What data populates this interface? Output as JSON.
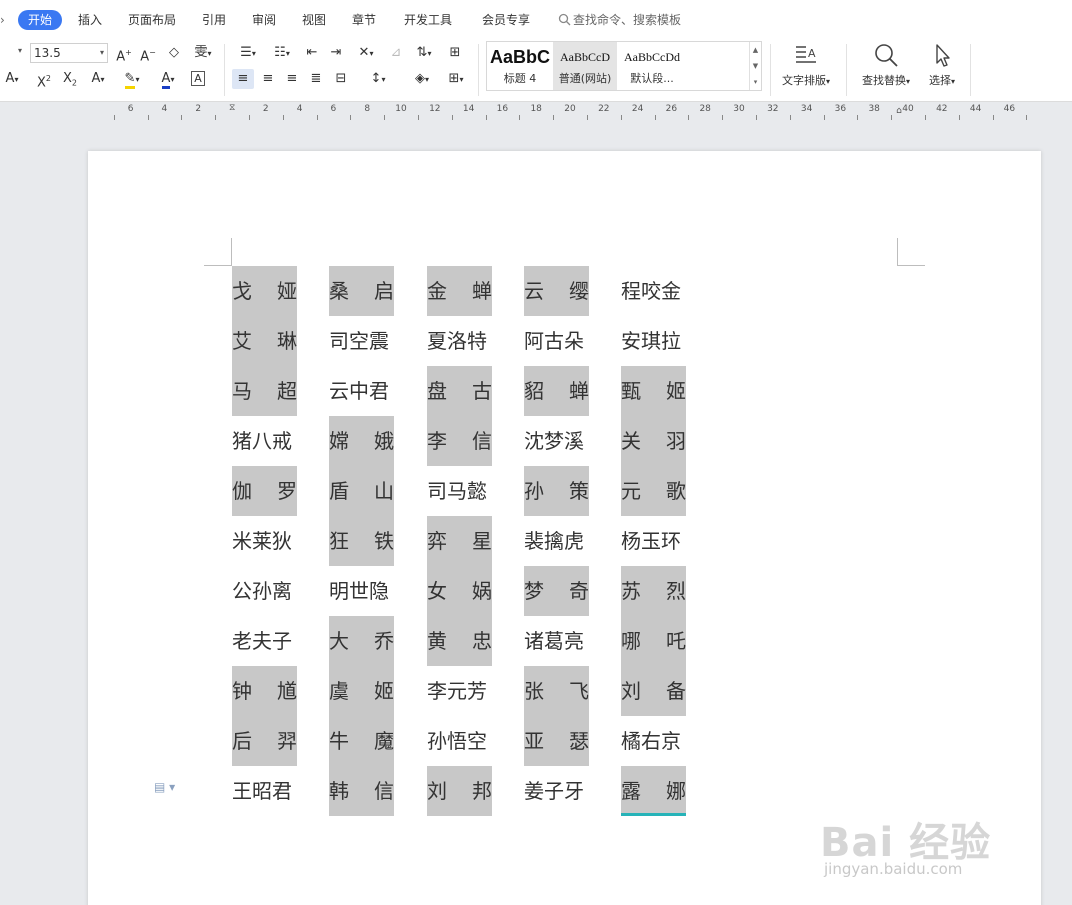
{
  "menu": {
    "items": [
      "开始",
      "插入",
      "页面布局",
      "引用",
      "审阅",
      "视图",
      "章节",
      "开发工具",
      "会员专享"
    ],
    "active_index": 0,
    "search_placeholder": "查找命令、搜索模板"
  },
  "ribbon": {
    "font_size": "13.5",
    "styles": [
      {
        "preview": "AaBbC",
        "label": "标题 4"
      },
      {
        "preview": "AaBbCcD",
        "label": "普通(网站)"
      },
      {
        "preview": "AaBbCcDd",
        "label": "默认段..."
      }
    ],
    "text_layout_label": "文字排版",
    "find_replace_label": "查找替换",
    "select_label": "选择"
  },
  "ruler": {
    "left_labels": [
      "6",
      "4",
      "2"
    ],
    "right_labels": [
      "2",
      "4",
      "6",
      "8",
      "10",
      "12",
      "14",
      "16",
      "18",
      "20",
      "22",
      "24",
      "26",
      "28",
      "30",
      "32",
      "34",
      "36",
      "38",
      "40",
      "42",
      "44",
      "46"
    ]
  },
  "document": {
    "columns": [
      [
        {
          "text": "戈 娅",
          "hl": true
        },
        {
          "text": "艾 琳",
          "hl": true
        },
        {
          "text": "马 超",
          "hl": true
        },
        {
          "text": "猪八戒",
          "hl": false
        },
        {
          "text": "伽 罗",
          "hl": true
        },
        {
          "text": "米莱狄",
          "hl": false
        },
        {
          "text": "公孙离",
          "hl": false
        },
        {
          "text": "老夫子",
          "hl": false
        },
        {
          "text": "钟 馗",
          "hl": true
        },
        {
          "text": "后 羿",
          "hl": true
        },
        {
          "text": "王昭君",
          "hl": false
        }
      ],
      [
        {
          "text": "桑 启",
          "hl": true
        },
        {
          "text": "司空震",
          "hl": false
        },
        {
          "text": "云中君",
          "hl": false
        },
        {
          "text": "嫦 娥",
          "hl": true
        },
        {
          "text": "盾 山",
          "hl": true
        },
        {
          "text": "狂 铁",
          "hl": true
        },
        {
          "text": "明世隐",
          "hl": false
        },
        {
          "text": "大 乔",
          "hl": true
        },
        {
          "text": "虞 姬",
          "hl": true
        },
        {
          "text": "牛 魔",
          "hl": true
        },
        {
          "text": "韩 信",
          "hl": true
        }
      ],
      [
        {
          "text": "金 蝉",
          "hl": true
        },
        {
          "text": "夏洛特",
          "hl": false
        },
        {
          "text": "盘 古",
          "hl": true
        },
        {
          "text": "李 信",
          "hl": true
        },
        {
          "text": "司马懿",
          "hl": false
        },
        {
          "text": "弈 星",
          "hl": true
        },
        {
          "text": "女 娲",
          "hl": true
        },
        {
          "text": "黄 忠",
          "hl": true
        },
        {
          "text": "李元芳",
          "hl": false
        },
        {
          "text": "孙悟空",
          "hl": false
        },
        {
          "text": "刘 邦",
          "hl": true
        }
      ],
      [
        {
          "text": "云 缨",
          "hl": true
        },
        {
          "text": "阿古朵",
          "hl": false
        },
        {
          "text": "貂 蝉",
          "hl": true
        },
        {
          "text": "沈梦溪",
          "hl": false
        },
        {
          "text": "孙 策",
          "hl": true
        },
        {
          "text": "裴擒虎",
          "hl": false
        },
        {
          "text": "梦 奇",
          "hl": true
        },
        {
          "text": "诸葛亮",
          "hl": false
        },
        {
          "text": "张 飞",
          "hl": true
        },
        {
          "text": "亚 瑟",
          "hl": true
        },
        {
          "text": "姜子牙",
          "hl": false
        }
      ],
      [
        {
          "text": "程咬金",
          "hl": false
        },
        {
          "text": "安琪拉",
          "hl": false
        },
        {
          "text": "甄 姬",
          "hl": true
        },
        {
          "text": "关 羽",
          "hl": true
        },
        {
          "text": "元 歌",
          "hl": true
        },
        {
          "text": "杨玉环",
          "hl": false
        },
        {
          "text": "苏 烈",
          "hl": true
        },
        {
          "text": "哪 吒",
          "hl": true
        },
        {
          "text": "刘 备",
          "hl": true
        },
        {
          "text": "橘右京",
          "hl": false
        },
        {
          "text": "露 娜",
          "hl": true,
          "underline": true
        }
      ]
    ],
    "highlight_color": "#c8c8c8",
    "cursor_underline_color": "#26b3b8"
  },
  "watermark": {
    "logo": "Bai 经验",
    "url": "jingyan.baidu.com"
  }
}
